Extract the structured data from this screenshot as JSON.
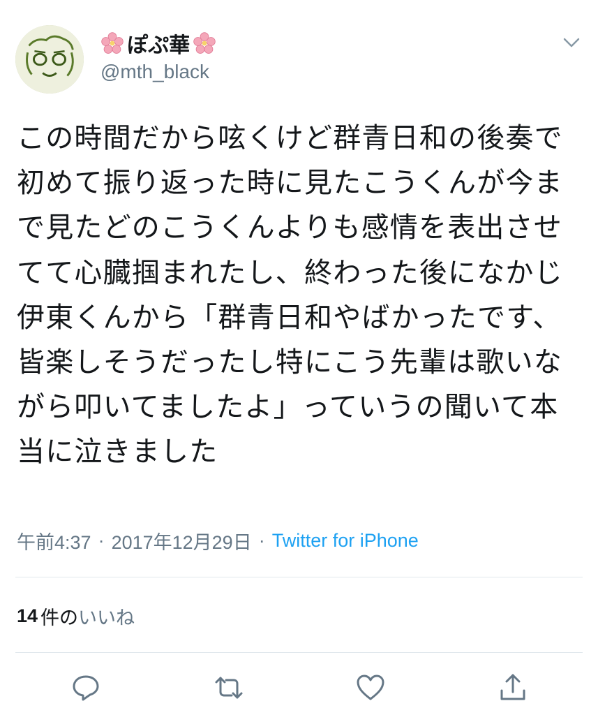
{
  "user": {
    "display_name": "ぽぷ華",
    "handle": "@mth_black",
    "name_decoration_icon": "cherry-blossom-icon"
  },
  "tweet": {
    "text": "この時間だから呟くけど群青日和の後奏で初めて振り返った時に見たこうくんが今まで見たどのこうくんよりも感情を表出させてて心臓掴まれたし、終わった後になかじ伊東くんから「群青日和やばかったです、皆楽しそうだったし特にこう先輩は歌いながら叩いてましたよ」っていうの聞いて本当に泣きました"
  },
  "meta": {
    "time": "午前4:37",
    "separator": "·",
    "date": "2017年12月29日",
    "source": "Twitter for iPhone"
  },
  "likes": {
    "count": "14",
    "label_part1": "件の",
    "label_part2": "いいね"
  },
  "actions": {
    "reply_icon": "reply-icon",
    "retweet_icon": "retweet-icon",
    "like_icon": "heart-icon",
    "share_icon": "share-icon"
  },
  "colors": {
    "text": "#14171a",
    "secondary": "#657786",
    "link": "#1da1f2",
    "divider": "#e1e8ed",
    "blossom": "#f4a7b9"
  }
}
